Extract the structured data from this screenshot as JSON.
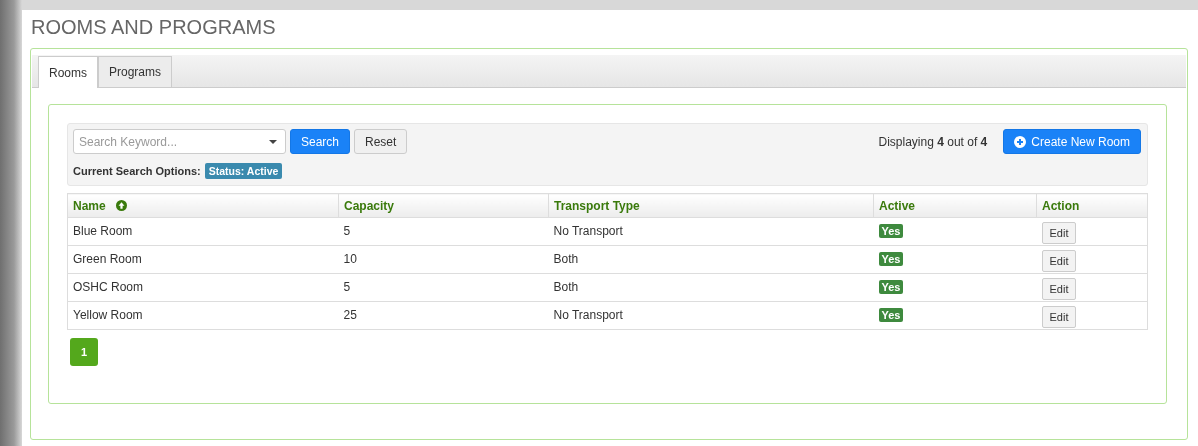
{
  "page": {
    "title": "ROOMS AND PROGRAMS"
  },
  "tabs": [
    {
      "label": "Rooms",
      "selected": true
    },
    {
      "label": "Programs",
      "selected": false
    }
  ],
  "search": {
    "placeholder": "Search Keyword...",
    "search_button": "Search",
    "reset_button": "Reset",
    "options_label": "Current Search Options:",
    "options": [
      {
        "label": "Status: Active"
      }
    ]
  },
  "summary": "Displaying **4** out of **4**",
  "create_button": "Create New Room",
  "table": {
    "columns": [
      {
        "label": "Name",
        "sorted": true
      },
      {
        "label": "Capacity",
        "sorted": false
      },
      {
        "label": "Transport Type",
        "sorted": false
      },
      {
        "label": "Active",
        "sorted": false
      },
      {
        "label": "Action",
        "sorted": false
      }
    ],
    "rows": [
      {
        "name": "Blue Room",
        "capacity": "5",
        "transport": "No Transport",
        "active": "Yes",
        "action": "Edit"
      },
      {
        "name": "Green Room",
        "capacity": "10",
        "transport": "Both",
        "active": "Yes",
        "action": "Edit"
      },
      {
        "name": "OSHC Room",
        "capacity": "5",
        "transport": "Both",
        "active": "Yes",
        "action": "Edit"
      },
      {
        "name": "Yellow Room",
        "capacity": "25",
        "transport": "No Transport",
        "active": "Yes",
        "action": "Edit"
      }
    ]
  },
  "pagination": [
    {
      "label": "1",
      "selected": true
    }
  ]
}
